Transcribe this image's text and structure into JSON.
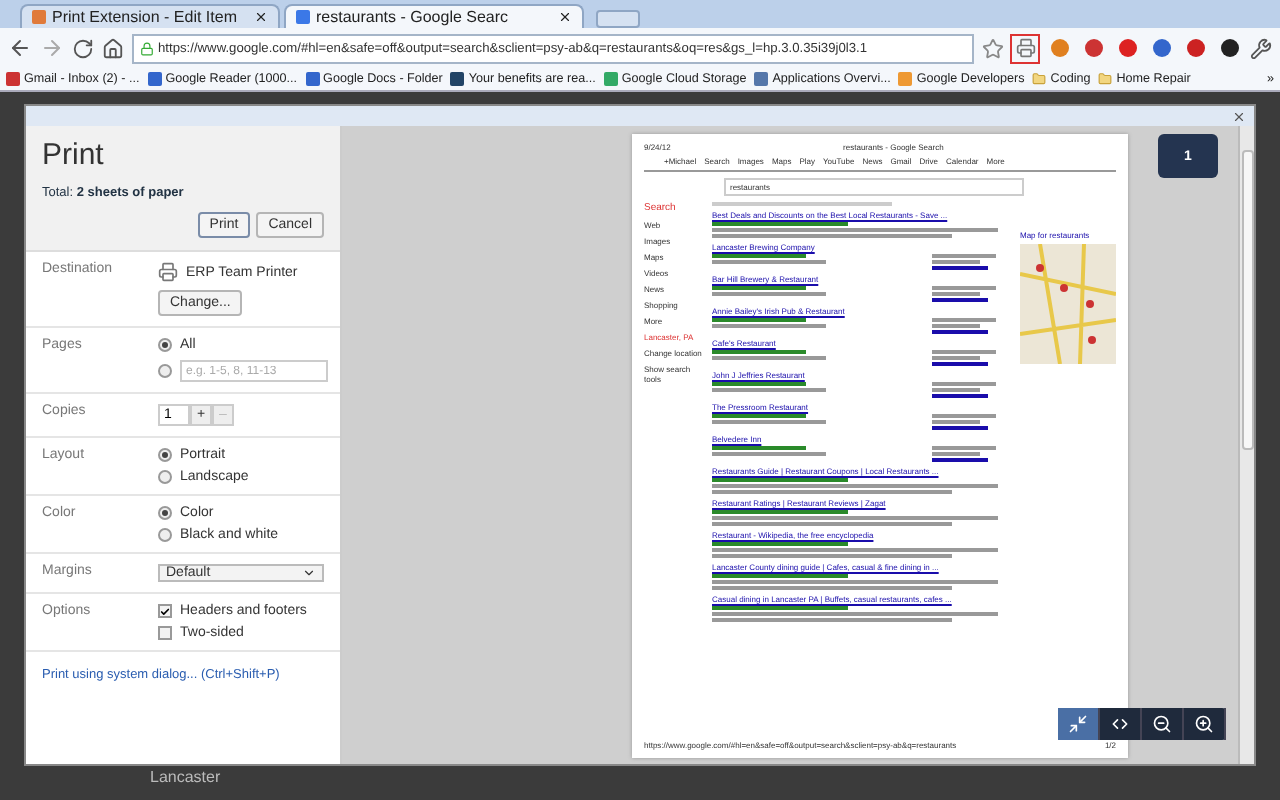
{
  "browser": {
    "tabs": [
      {
        "title": "Print Extension - Edit Item",
        "selected": false
      },
      {
        "title": "restaurants - Google Searc",
        "selected": true
      }
    ],
    "address": {
      "url": "https://www.google.com/#hl=en&safe=off&output=search&sclient=psy-ab&q=restaurants&oq=res&gs_l=hp.3.0.35i39j0l3.1"
    },
    "bookmarks": [
      {
        "label": "Gmail - Inbox (2) - ...",
        "kind": "page"
      },
      {
        "label": "Google Reader (1000...",
        "kind": "page"
      },
      {
        "label": "Google Docs - Folder",
        "kind": "page"
      },
      {
        "label": "Your benefits are rea...",
        "kind": "page"
      },
      {
        "label": "Google Cloud Storage",
        "kind": "page"
      },
      {
        "label": "Applications Overvi...",
        "kind": "page"
      },
      {
        "label": "Google Developers",
        "kind": "page"
      },
      {
        "label": "Coding",
        "kind": "folder"
      },
      {
        "label": "Home Repair",
        "kind": "folder"
      }
    ],
    "bookmarks_overflow": "»"
  },
  "dialog": {
    "title": "Print",
    "total": "Total: **2 sheets of paper**",
    "buttons": [
      {
        "label": "Print",
        "primary": true
      },
      {
        "label": "Cancel",
        "primary": false
      }
    ],
    "settings": [
      {
        "kind": "destination",
        "label": "Destination",
        "printer": "ERP Team Printer",
        "button": "Change..."
      },
      {
        "kind": "radio",
        "label": "Pages",
        "options": [
          {
            "label": "All",
            "selected": true
          },
          {
            "placeholder": "e.g. 1-5, 8, 11-13",
            "selected": false
          }
        ]
      },
      {
        "kind": "copies",
        "label": "Copies",
        "value": "1",
        "steppers": [
          {
            "text": "+",
            "disabled": false
          },
          {
            "text": "–",
            "disabled": true
          }
        ]
      },
      {
        "kind": "radio",
        "label": "Layout",
        "options": [
          {
            "label": "Portrait",
            "selected": true
          },
          {
            "label": "Landscape",
            "selected": false
          }
        ]
      },
      {
        "kind": "radio",
        "label": "Color",
        "options": [
          {
            "label": "Color",
            "selected": true
          },
          {
            "label": "Black and white",
            "selected": false
          }
        ]
      },
      {
        "kind": "select",
        "label": "Margins",
        "value": "Default"
      },
      {
        "kind": "checks",
        "label": "Options",
        "options": [
          {
            "label": "Headers and footers",
            "checked": true
          },
          {
            "label": "Two-sided",
            "checked": false
          }
        ]
      }
    ],
    "system_link": "Print using system dialog... (Ctrl+Shift+P)"
  },
  "preview": {
    "page_badge": "1",
    "page": {
      "date": "9/24/12",
      "title": "restaurants - Google Search",
      "nav": [
        "+Michael",
        "Search",
        "Images",
        "Maps",
        "Play",
        "YouTube",
        "News",
        "Gmail",
        "Drive",
        "Calendar",
        "More"
      ],
      "query": "restaurants",
      "search_label": "Search",
      "side_links": [
        "Web",
        "Images",
        "Maps",
        "Videos",
        "News",
        "Shopping",
        "More"
      ],
      "location": "Lancaster, PA",
      "change_location": "Change location",
      "search_tools": "Show search tools",
      "results": [
        {
          "title": "Best Deals and Discounts on the Best Local Restaurants - Save ...",
          "local": false
        },
        {
          "title": "Lancaster Brewing Company",
          "local": true
        },
        {
          "title": "Bar Hill Brewery & Restaurant",
          "local": true
        },
        {
          "title": "Annie Bailey's Irish Pub & Restaurant",
          "local": true
        },
        {
          "title": "Cafe's Restaurant",
          "local": true
        },
        {
          "title": "John J Jeffries Restaurant",
          "local": true
        },
        {
          "title": "The Pressroom Restaurant",
          "local": true
        },
        {
          "title": "Belvedere Inn",
          "local": true
        },
        {
          "title": "Restaurants Guide | Restaurant Coupons | Local Restaurants ...",
          "local": false
        },
        {
          "title": "Restaurant Ratings | Restaurant Reviews | Zagat",
          "local": false
        },
        {
          "title": "Restaurant - Wikipedia, the free encyclopedia",
          "local": false
        },
        {
          "title": "Lancaster County dining guide | Cafes, casual & fine dining in ...",
          "local": false
        },
        {
          "title": "Casual dining in Lancaster PA | Buffets, casual restaurants, cafes ...",
          "local": false
        }
      ],
      "map_title": "Map for restaurants",
      "footer_url": "https://www.google.com/#hl=en&safe=off&output=search&sclient=psy-ab&q=restaurants",
      "page_number": "1/2"
    }
  },
  "background_text": "Lancaster"
}
